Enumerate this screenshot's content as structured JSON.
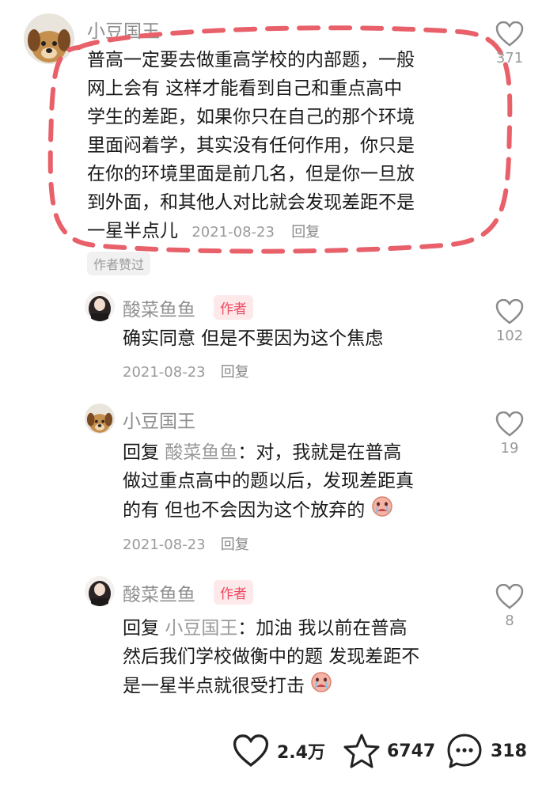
{
  "comments": [
    {
      "user": "小豆国王",
      "lines": [
        "普高一定要去做重高学校的内部题，一般",
        "网上会有 这样才能看到自己和重点高中",
        "学生的差距，如果你只在自己的那个环境",
        "里面闷着学，其实没有任何作用，你只是",
        "在你的环境里面是前几名，但是你一旦放",
        "到外面，和其他人对比就会发现差距不是",
        "一星半点儿"
      ],
      "date": "2021-08-23",
      "reply": "回复",
      "liked_by_author": "作者赞过",
      "likes": "371"
    },
    {
      "user": "酸菜鱼鱼",
      "badge": "作者",
      "lines": [
        "确实同意 但是不要因为这个焦虑"
      ],
      "date": "2021-08-23",
      "reply": "回复",
      "likes": "102"
    },
    {
      "user": "小豆国王",
      "reply_prefix": "回复",
      "mention": "酸菜鱼鱼",
      "first_line_rest": "：对，我就是在普高",
      "lines": [
        "做过重点高中的题以后，发现差距真",
        "的有 但也不会因为这个放弃的"
      ],
      "date": "2021-08-23",
      "reply": "回复",
      "likes": "19"
    },
    {
      "user": "酸菜鱼鱼",
      "badge": "作者",
      "reply_prefix": "回复",
      "mention": "小豆国王",
      "first_line_rest": "：加油 我以前在普高",
      "lines": [
        "然后我们学校做衡中的题 发现差距不",
        "是一星半点就很受打击"
      ],
      "likes": "8"
    }
  ],
  "bottom_bar": {
    "likes": "2.4万",
    "favorites": "6747",
    "comments": "318"
  },
  "icons": {
    "like": "heart-outline-icon",
    "favorite": "star-outline-icon",
    "comment": "chat-bubble-icon",
    "emoji": "crying-face-emoji"
  },
  "colors": {
    "highlight_dash": "#e8606a",
    "author_badge_bg": "#fde8ea",
    "author_badge_text": "#ee4960"
  }
}
